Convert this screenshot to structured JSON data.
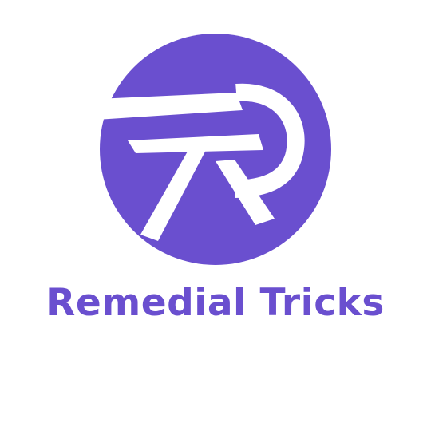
{
  "brand": {
    "name": "Remedial Tricks",
    "logo_icon": "r-monogram-circle-logo",
    "colors": {
      "primary": "#6a4fcf",
      "mark": "#ffffff",
      "background": "#ffffff"
    }
  }
}
